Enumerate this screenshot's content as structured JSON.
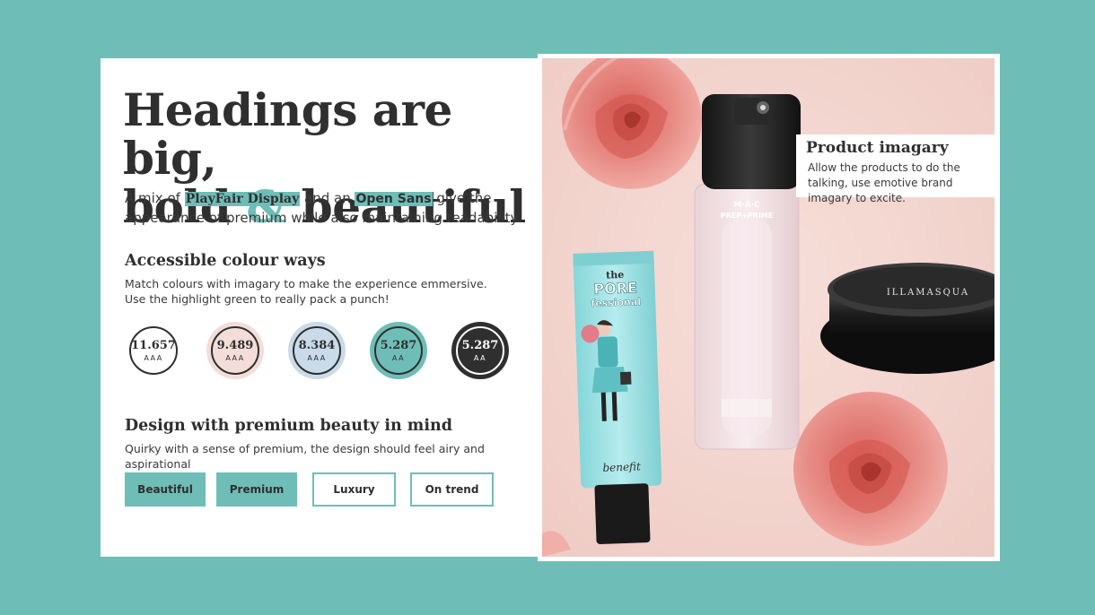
{
  "headline": {
    "line1": "Headings are big,",
    "line2_start": "bold",
    "ampersand": "&",
    "line2_end": "beautiful"
  },
  "intro": {
    "prefix": "A mix of",
    "serif_font": "PlayFair Display",
    "middle": "and an",
    "sans_font": "Open Sans",
    "suffix": "give the appearance of premium while also maintaining readability."
  },
  "colour_section": {
    "title": "Accessible colour ways",
    "line1": "Match colours with imagary to make the experience emmersive.",
    "line2": "Use the highlight green to really pack a punch!",
    "swatches": [
      {
        "ratio": "11.657",
        "grade": "AAA",
        "color": "#ffffff"
      },
      {
        "ratio": "9.489",
        "grade": "AAA",
        "color": "#f3ddd9"
      },
      {
        "ratio": "8.384",
        "grade": "AAA",
        "color": "#c9dbe9"
      },
      {
        "ratio": "5.287",
        "grade": "AA",
        "color": "#6fbdb7"
      },
      {
        "ratio": "5.287",
        "grade": "AA",
        "color": "#2f2f2f"
      }
    ]
  },
  "design_section": {
    "title": "Design with premium beauty in mind",
    "text": "Quirky with a sense of premium, the design should feel airy and aspirational",
    "tags": [
      {
        "label": "Beautiful",
        "style": "filled"
      },
      {
        "label": "Premium",
        "style": "filled"
      },
      {
        "label": "Luxury",
        "style": "outline"
      },
      {
        "label": "On trend",
        "style": "outline"
      }
    ]
  },
  "product_box": {
    "title": "Product imagary",
    "text": "Allow the products to do the talking, use emotive brand imagary to excite."
  },
  "product_image": {
    "tube_brand": "benefit",
    "tube_line1": "the",
    "tube_line2": "PORE",
    "tube_line3": "fessional",
    "bottle_brand": "M·A·C",
    "bottle_name": "PREP+PRIME",
    "jar_brand": "ILLAMASQUA"
  },
  "colors": {
    "background": "#6fbdb7",
    "accent": "#6fbdb7",
    "text": "#2f2f2f",
    "photo_bg": "#f1d3cd"
  }
}
